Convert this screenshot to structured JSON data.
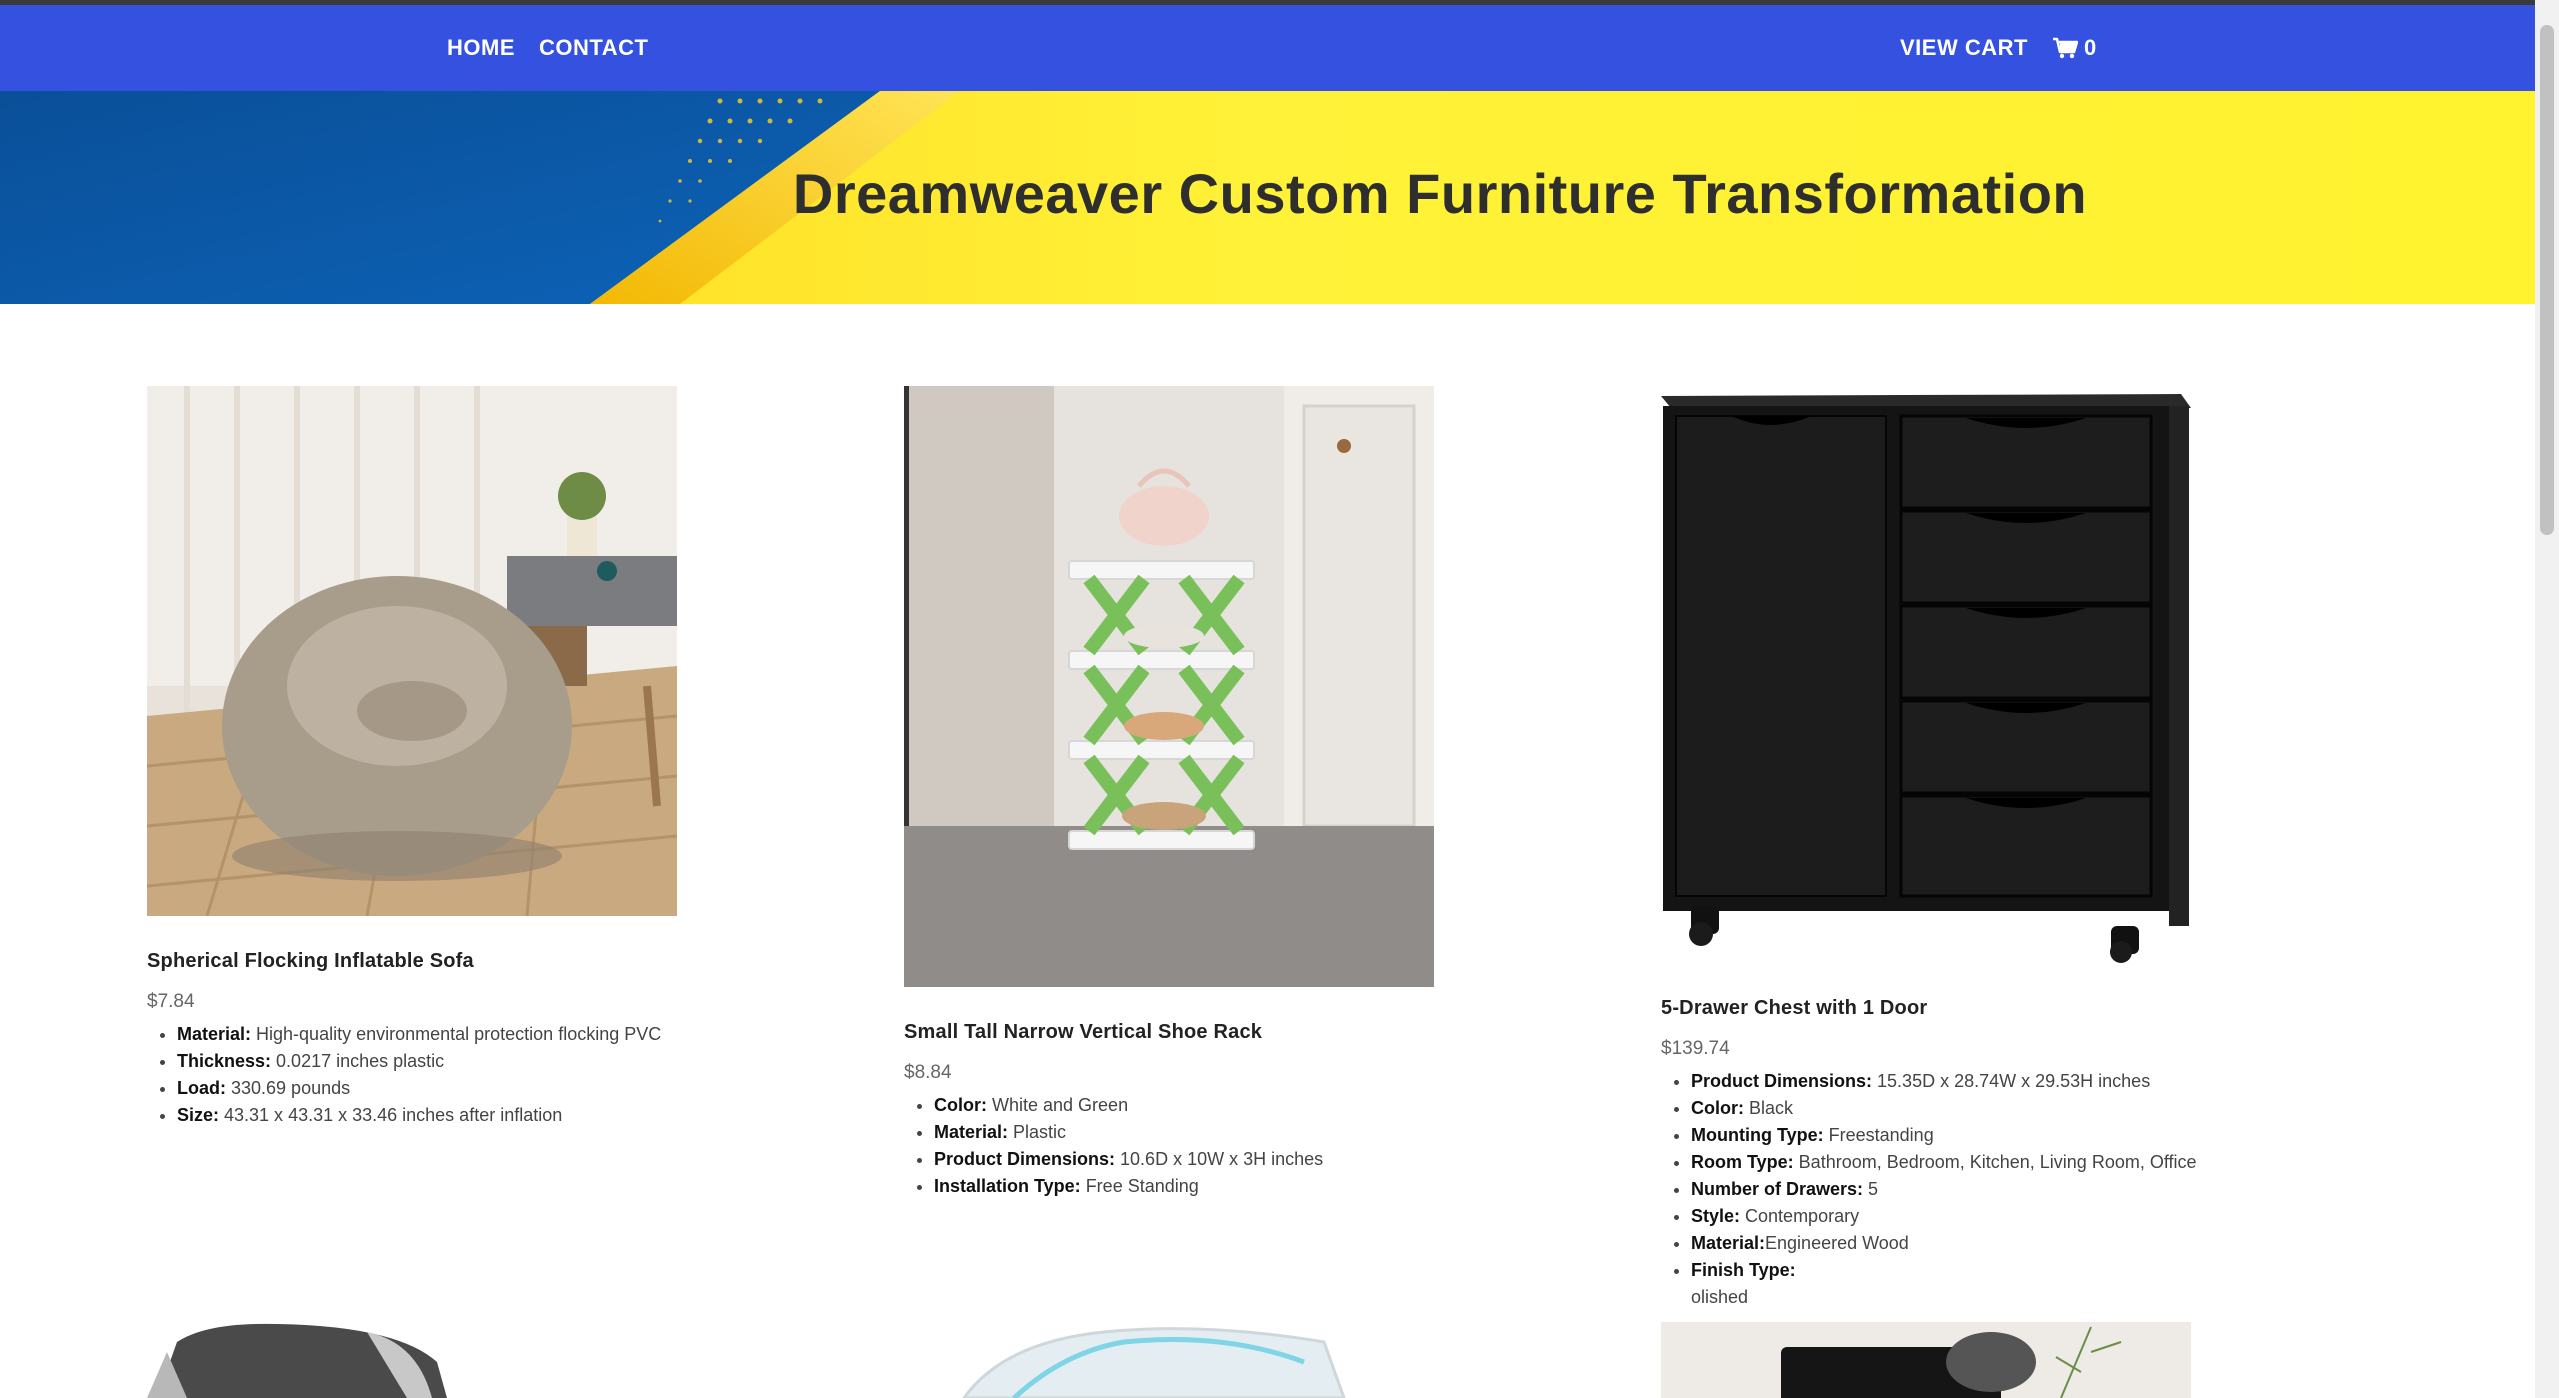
{
  "nav": {
    "home": "HOME",
    "contact": "CONTACT",
    "view_cart": "VIEW CART",
    "cart_count": "0"
  },
  "hero": {
    "title": "Dreamweaver Custom Furniture Transformation"
  },
  "products": [
    {
      "name": "Spherical Flocking Inflatable Sofa",
      "price": "$7.84",
      "specs": [
        {
          "label": "Material:",
          "value": " High-quality environmental protection flocking PVC"
        },
        {
          "label": "Thickness:",
          "value": " 0.0217 inches plastic"
        },
        {
          "label": "Load:",
          "value": " 330.69 pounds"
        },
        {
          "label": "Size:",
          "value": " 43.31 x 43.31 x 33.46 inches after inflation"
        }
      ]
    },
    {
      "name": "Small Tall Narrow Vertical Shoe Rack",
      "price": "$8.84",
      "specs": [
        {
          "label": "Color:",
          "value": " White and Green"
        },
        {
          "label": "Material:",
          "value": " Plastic"
        },
        {
          "label": "Product Dimensions:",
          "value": " 10.6D x 10W x 3H inches"
        },
        {
          "label": "Installation Type:",
          "value": " Free Standing"
        }
      ]
    },
    {
      "name": "5-Drawer Chest with 1 Door",
      "price": "$139.74",
      "specs": [
        {
          "label": "Product Dimensions:",
          "value": " 15.35D x 28.74W x 29.53H inches"
        },
        {
          "label": "Color:",
          "value": " Black"
        },
        {
          "label": "Mounting Type:",
          "value": " Freestanding"
        },
        {
          "label": "Room Type:",
          "value": " Bathroom, Bedroom, Kitchen, Living Room, Office"
        },
        {
          "label": "Number of Drawers:",
          "value": " 5"
        },
        {
          "label": "Style:",
          "value": " Contemporary"
        },
        {
          "label": "Material:",
          "value": "Engineered Wood"
        },
        {
          "label": "Finish Type:",
          "value": ""
        }
      ],
      "extra_line": "olished"
    }
  ],
  "colors": {
    "nav_bg": "#3451e0",
    "hero_yellow": "#ffee3a",
    "hero_blue": "#0b5aa6"
  }
}
